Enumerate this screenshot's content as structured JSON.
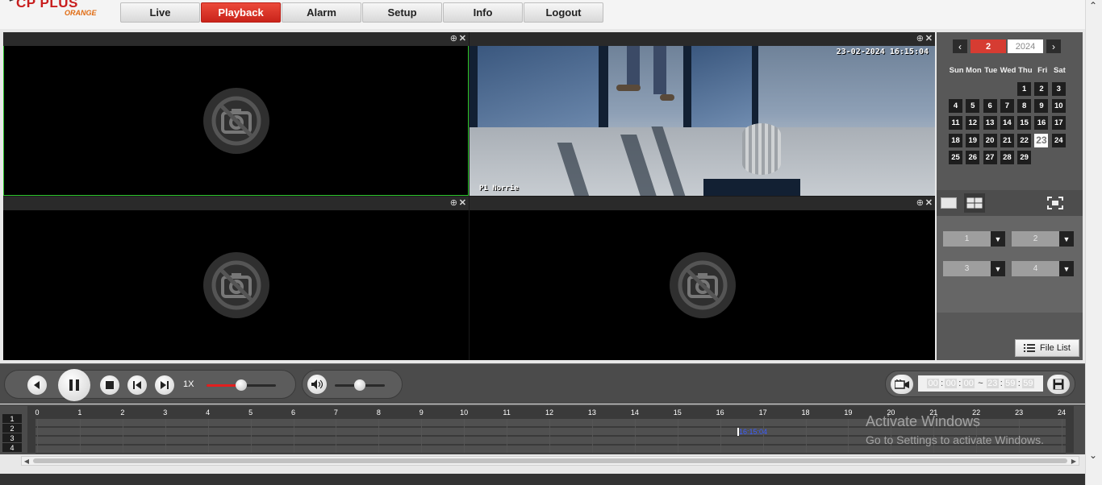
{
  "brand": {
    "logo_text": "CP PLUS",
    "logo_sub": "ORANGE"
  },
  "nav": {
    "tabs": [
      {
        "label": "Live",
        "active": false
      },
      {
        "label": "Playback",
        "active": true
      },
      {
        "label": "Alarm",
        "active": false
      },
      {
        "label": "Setup",
        "active": false
      },
      {
        "label": "Info",
        "active": false
      },
      {
        "label": "Logout",
        "active": false
      }
    ]
  },
  "panes": [
    {
      "channel": 1,
      "has_video": false,
      "selected": true
    },
    {
      "channel": 2,
      "has_video": true,
      "selected": false,
      "osd_time": "23-02-2024 16:15:04",
      "osd_name": "P1 Norrie"
    },
    {
      "channel": 3,
      "has_video": false,
      "selected": false
    },
    {
      "channel": 4,
      "has_video": false,
      "selected": false
    }
  ],
  "calendar": {
    "prev": "‹",
    "next": "›",
    "month": "2",
    "year": "2024",
    "weekdays": [
      "Sun",
      "Mon",
      "Tue",
      "Wed",
      "Thu",
      "Fri",
      "Sat"
    ],
    "days": [
      "",
      "",
      "",
      "",
      "1",
      "2",
      "3",
      "4",
      "5",
      "6",
      "7",
      "8",
      "9",
      "10",
      "11",
      "12",
      "13",
      "14",
      "15",
      "16",
      "17",
      "18",
      "19",
      "20",
      "21",
      "22",
      "23",
      "24",
      "25",
      "26",
      "27",
      "28",
      "29",
      "",
      ""
    ],
    "today": "23"
  },
  "channel_selectors": [
    "1",
    "2",
    "3",
    "4"
  ],
  "file_list": {
    "label": "File List"
  },
  "controls": {
    "speed": "1X",
    "speed_level": 0.5,
    "volume_level": 0.5
  },
  "time_range": {
    "start": [
      "00",
      "00",
      "00"
    ],
    "separator": ":",
    "range_sep": "~",
    "end": [
      "23",
      "59",
      "59"
    ]
  },
  "timeline": {
    "channels": [
      "1",
      "2",
      "3",
      "4"
    ],
    "hours": [
      "0",
      "1",
      "2",
      "3",
      "4",
      "5",
      "6",
      "7",
      "8",
      "9",
      "10",
      "11",
      "12",
      "13",
      "14",
      "15",
      "16",
      "17",
      "18",
      "19",
      "20",
      "21",
      "22",
      "23",
      "24"
    ],
    "cursor_time": "16:15:04"
  },
  "watermark": {
    "line1": "Activate Windows",
    "line2": "Go to Settings to activate Windows."
  },
  "colors": {
    "accent": "#d63c32",
    "selected_pane": "#2cc52c",
    "timeline_time": "#3a5cff"
  }
}
